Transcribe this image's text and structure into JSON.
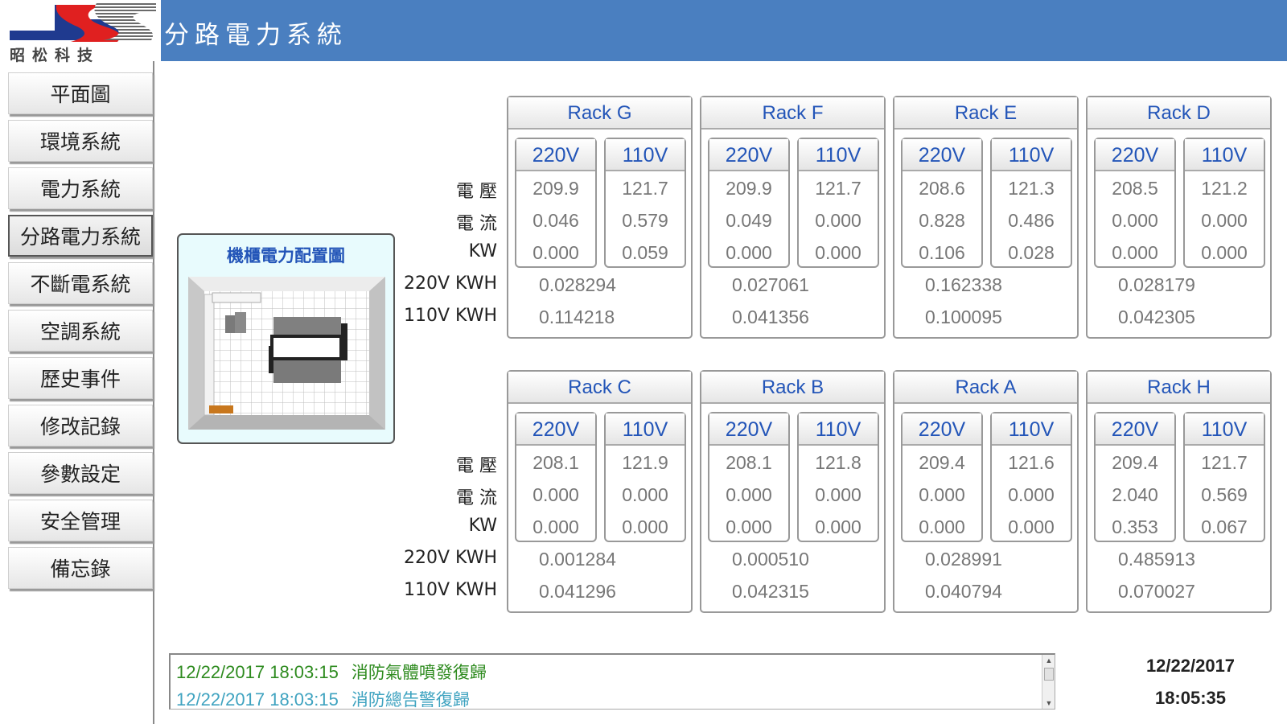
{
  "app": {
    "logo_text": "昭松科技",
    "title": "分路電力系統"
  },
  "sidebar": {
    "items": [
      {
        "label": "平面圖"
      },
      {
        "label": "環境系統"
      },
      {
        "label": "電力系統"
      },
      {
        "label": "分路電力系統",
        "active": true
      },
      {
        "label": "不斷電系統"
      },
      {
        "label": "空調系統"
      },
      {
        "label": "歷史事件"
      },
      {
        "label": "修改記錄"
      },
      {
        "label": "參數設定"
      },
      {
        "label": "安全管理"
      },
      {
        "label": "備忘錄"
      }
    ]
  },
  "floorplan": {
    "title": "機櫃電力配置圖"
  },
  "row_labels": {
    "voltage": "電 壓",
    "current": "電 流",
    "kw": "KW",
    "kwh220": "220V KWH",
    "kwh110": "110V KWH"
  },
  "racks": [
    {
      "name": "Rack G",
      "v220": {
        "label": "220V",
        "voltage": "209.9",
        "current": "0.046",
        "kw": "0.000"
      },
      "v110": {
        "label": "110V",
        "voltage": "121.7",
        "current": "0.579",
        "kw": "0.059"
      },
      "kwh220": "0.028294",
      "kwh110": "0.114218"
    },
    {
      "name": "Rack F",
      "v220": {
        "label": "220V",
        "voltage": "209.9",
        "current": "0.049",
        "kw": "0.000"
      },
      "v110": {
        "label": "110V",
        "voltage": "121.7",
        "current": "0.000",
        "kw": "0.000"
      },
      "kwh220": "0.027061",
      "kwh110": "0.041356"
    },
    {
      "name": "Rack E",
      "v220": {
        "label": "220V",
        "voltage": "208.6",
        "current": "0.828",
        "kw": "0.106"
      },
      "v110": {
        "label": "110V",
        "voltage": "121.3",
        "current": "0.486",
        "kw": "0.028"
      },
      "kwh220": "0.162338",
      "kwh110": "0.100095"
    },
    {
      "name": "Rack D",
      "v220": {
        "label": "220V",
        "voltage": "208.5",
        "current": "0.000",
        "kw": "0.000"
      },
      "v110": {
        "label": "110V",
        "voltage": "121.2",
        "current": "0.000",
        "kw": "0.000"
      },
      "kwh220": "0.028179",
      "kwh110": "0.042305"
    },
    {
      "name": "Rack C",
      "v220": {
        "label": "220V",
        "voltage": "208.1",
        "current": "0.000",
        "kw": "0.000"
      },
      "v110": {
        "label": "110V",
        "voltage": "121.9",
        "current": "0.000",
        "kw": "0.000"
      },
      "kwh220": "0.001284",
      "kwh110": "0.041296"
    },
    {
      "name": "Rack B",
      "v220": {
        "label": "220V",
        "voltage": "208.1",
        "current": "0.000",
        "kw": "0.000"
      },
      "v110": {
        "label": "110V",
        "voltage": "121.8",
        "current": "0.000",
        "kw": "0.000"
      },
      "kwh220": "0.000510",
      "kwh110": "0.042315"
    },
    {
      "name": "Rack A",
      "v220": {
        "label": "220V",
        "voltage": "209.4",
        "current": "0.000",
        "kw": "0.000"
      },
      "v110": {
        "label": "110V",
        "voltage": "121.6",
        "current": "0.000",
        "kw": "0.000"
      },
      "kwh220": "0.028991",
      "kwh110": "0.040794"
    },
    {
      "name": "Rack H",
      "v220": {
        "label": "220V",
        "voltage": "209.4",
        "current": "2.040",
        "kw": "0.353"
      },
      "v110": {
        "label": "110V",
        "voltage": "121.7",
        "current": "0.569",
        "kw": "0.067"
      },
      "kwh220": "0.485913",
      "kwh110": "0.070027"
    }
  ],
  "events": [
    {
      "timestamp": "12/22/2017 18:03:15",
      "message": "消防氣體噴發復歸",
      "color": "#2e8b1f"
    },
    {
      "timestamp": "12/22/2017 18:03:15",
      "message": "消防總告警復歸",
      "color": "#3fa3c0"
    }
  ],
  "clock": {
    "date": "12/22/2017",
    "time": "18:05:35"
  },
  "colors": {
    "title_bar": "#4a7fc0",
    "rack_text": "#2355b8",
    "value_text": "#777777"
  }
}
